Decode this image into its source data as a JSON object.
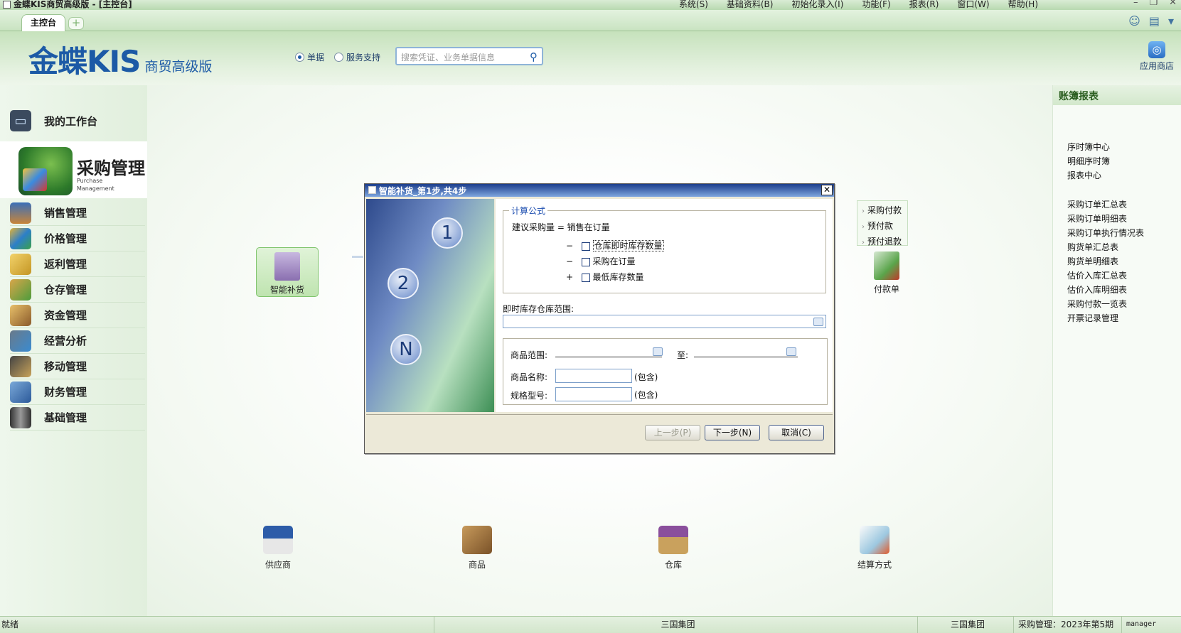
{
  "window": {
    "title": "金蝶KIS商贸高级版 - [主控台]"
  },
  "menubar": [
    "系统(S)",
    "基础资料(B)",
    "初始化录入(I)",
    "功能(F)",
    "报表(R)",
    "窗口(W)",
    "帮助(H)"
  ],
  "tabs": {
    "main_label": "主控台",
    "add_glyph": "+"
  },
  "header": {
    "logo_main": "金蝶KIS",
    "logo_sub": "商贸高级版",
    "radio_docs": "单据",
    "radio_service": "服务支持",
    "search_placeholder": "搜索凭证、业务单据信息",
    "app_store": "应用商店"
  },
  "nav": {
    "workbench": "我的工作台",
    "active_title": "采购管理",
    "active_sub1": "Purchase",
    "active_sub2": "Management",
    "items": [
      "销售管理",
      "价格管理",
      "返利管理",
      "仓存管理",
      "资金管理",
      "经营分析",
      "移动管理",
      "财务管理",
      "基础管理"
    ]
  },
  "flow": {
    "smart_replenish": "智能补货",
    "right_menu": [
      "采购付款",
      "预付款",
      "预付退款"
    ],
    "payment_doc": "付款单",
    "supplier": "供应商",
    "goods": "商品",
    "warehouse": "仓库",
    "settlement": "结算方式"
  },
  "rightpanel": {
    "title": "账簿报表",
    "group1": [
      "序时簿中心",
      "明细序时簿",
      "报表中心"
    ],
    "group2": [
      "采购订单汇总表",
      "采购订单明细表",
      "采购订单执行情况表",
      "购货单汇总表",
      "购货单明细表",
      "估价入库汇总表",
      "估价入库明细表",
      "采购付款一览表",
      "开票记录管理"
    ]
  },
  "dialog": {
    "title": "智能补货_第1步,共4步",
    "close": "✕",
    "steps": [
      "1",
      "2",
      "N"
    ],
    "formula_legend": "计算公式",
    "formula_line": "建议采购量 = 销售在订量",
    "terms": [
      {
        "op": "−",
        "label": "仓库即时库存数量"
      },
      {
        "op": "−",
        "label": "采购在订量"
      },
      {
        "op": "+",
        "label": "最低库存数量"
      }
    ],
    "wh_range_label": "即时库存仓库范围:",
    "goods_range_label": "商品范围:",
    "to_label": "至:",
    "goods_name_label": "商品名称:",
    "spec_label": "规格型号:",
    "contains": "(包含)",
    "btn_prev": "上一步(P)",
    "btn_next": "下一步(N)",
    "btn_cancel": "取消(C)"
  },
  "status": {
    "ready": "就绪",
    "company": "三国集团",
    "company2": "三国集团",
    "period": "采购管理：2023年第5期",
    "user": "manager"
  }
}
